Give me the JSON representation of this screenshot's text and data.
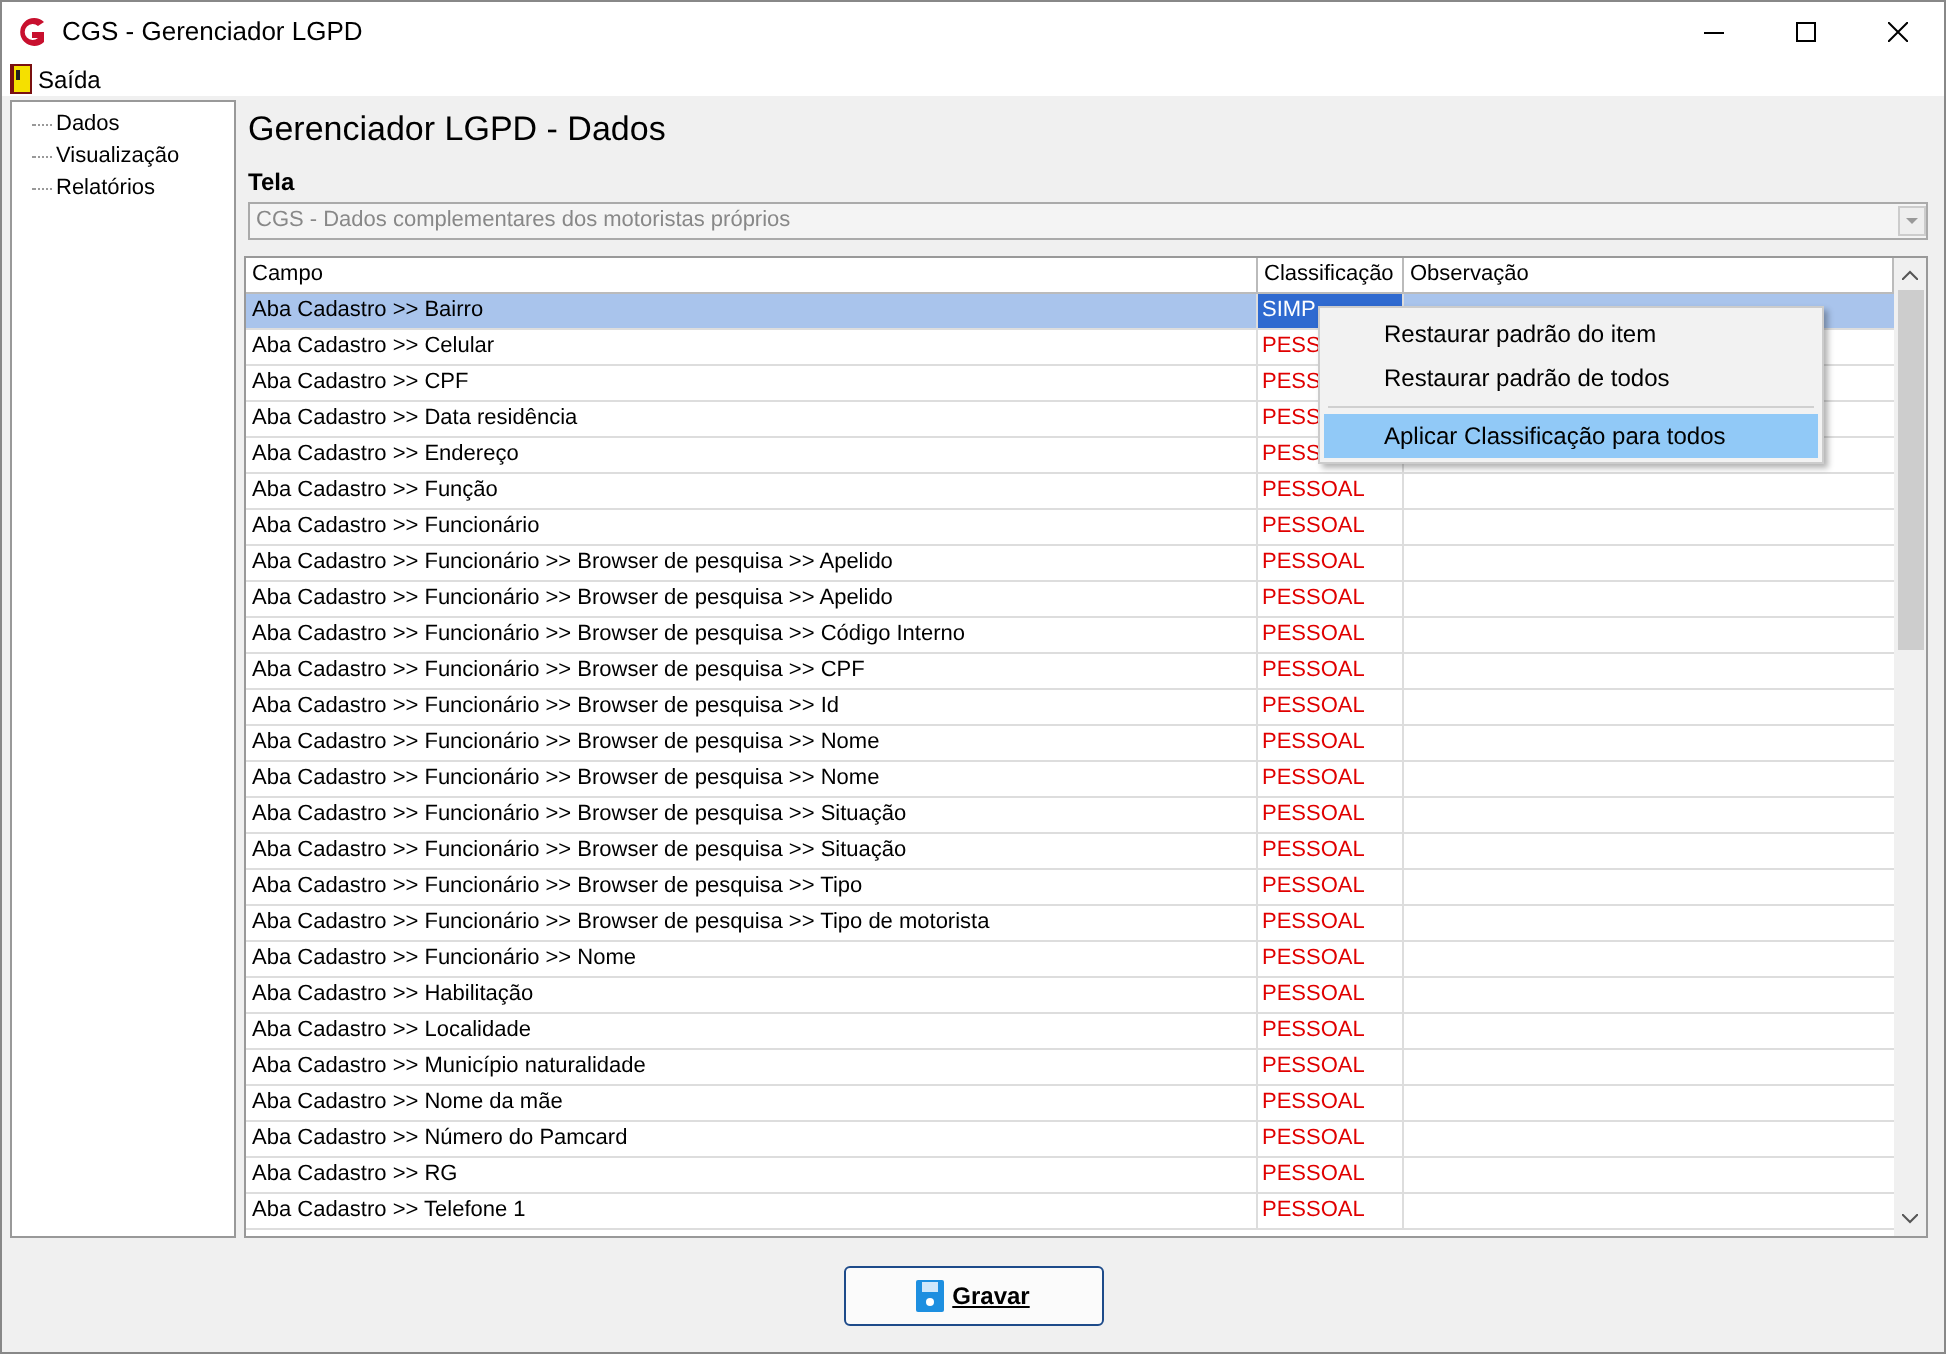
{
  "window": {
    "title": "CGS - Gerenciador LGPD"
  },
  "menu": [
    {
      "label": "Saída"
    }
  ],
  "tree": [
    {
      "label": "Dados"
    },
    {
      "label": "Visualização"
    },
    {
      "label": "Relatórios"
    }
  ],
  "heading": "Gerenciador LGPD - Dados",
  "tela": {
    "label": "Tela",
    "value": "CGS - Dados complementares dos motoristas próprios"
  },
  "table": {
    "columns": [
      "Campo",
      "Classificação",
      "Observação"
    ],
    "rows": [
      {
        "campo": "Aba Cadastro >> Bairro",
        "classificacao": "SIMP",
        "selected": true
      },
      {
        "campo": "Aba Cadastro >> Celular",
        "classificacao": "PESS",
        "selected": false
      },
      {
        "campo": "Aba Cadastro >> CPF",
        "classificacao": "PESS",
        "selected": false
      },
      {
        "campo": "Aba Cadastro >> Data residência",
        "classificacao": "PESS",
        "selected": false
      },
      {
        "campo": "Aba Cadastro >> Endereço",
        "classificacao": "PESS",
        "selected": false
      },
      {
        "campo": "Aba Cadastro >> Função",
        "classificacao": "PESSOAL",
        "selected": false
      },
      {
        "campo": "Aba Cadastro >> Funcionário",
        "classificacao": "PESSOAL",
        "selected": false
      },
      {
        "campo": "Aba Cadastro >> Funcionário >> Browser de pesquisa >> Apelido",
        "classificacao": "PESSOAL",
        "selected": false
      },
      {
        "campo": "Aba Cadastro >> Funcionário >> Browser de pesquisa >> Apelido",
        "classificacao": "PESSOAL",
        "selected": false
      },
      {
        "campo": "Aba Cadastro >> Funcionário >> Browser de pesquisa >> Código Interno",
        "classificacao": "PESSOAL",
        "selected": false
      },
      {
        "campo": "Aba Cadastro >> Funcionário >> Browser de pesquisa >> CPF",
        "classificacao": "PESSOAL",
        "selected": false
      },
      {
        "campo": "Aba Cadastro >> Funcionário >> Browser de pesquisa >> Id",
        "classificacao": "PESSOAL",
        "selected": false
      },
      {
        "campo": "Aba Cadastro >> Funcionário >> Browser de pesquisa >> Nome",
        "classificacao": "PESSOAL",
        "selected": false
      },
      {
        "campo": "Aba Cadastro >> Funcionário >> Browser de pesquisa >> Nome",
        "classificacao": "PESSOAL",
        "selected": false
      },
      {
        "campo": "Aba Cadastro >> Funcionário >> Browser de pesquisa >> Situação",
        "classificacao": "PESSOAL",
        "selected": false
      },
      {
        "campo": "Aba Cadastro >> Funcionário >> Browser de pesquisa >> Situação",
        "classificacao": "PESSOAL",
        "selected": false
      },
      {
        "campo": "Aba Cadastro >> Funcionário >> Browser de pesquisa >> Tipo",
        "classificacao": "PESSOAL",
        "selected": false
      },
      {
        "campo": "Aba Cadastro >> Funcionário >> Browser de pesquisa >> Tipo de motorista",
        "classificacao": "PESSOAL",
        "selected": false
      },
      {
        "campo": "Aba Cadastro >> Funcionário >> Nome",
        "classificacao": "PESSOAL",
        "selected": false
      },
      {
        "campo": "Aba Cadastro >> Habilitação",
        "classificacao": "PESSOAL",
        "selected": false
      },
      {
        "campo": "Aba Cadastro >> Localidade",
        "classificacao": "PESSOAL",
        "selected": false
      },
      {
        "campo": "Aba Cadastro >> Município naturalidade",
        "classificacao": "PESSOAL",
        "selected": false
      },
      {
        "campo": "Aba Cadastro >> Nome da mãe",
        "classificacao": "PESSOAL",
        "selected": false
      },
      {
        "campo": "Aba Cadastro >> Número do Pamcard",
        "classificacao": "PESSOAL",
        "selected": false
      },
      {
        "campo": "Aba Cadastro >> RG",
        "classificacao": "PESSOAL",
        "selected": false
      },
      {
        "campo": "Aba Cadastro >> Telefone 1",
        "classificacao": "PESSOAL",
        "selected": false
      }
    ]
  },
  "context_menu": [
    {
      "label": "Restaurar padrão do item",
      "selected": false
    },
    {
      "label": "Restaurar padrão de todos",
      "selected": false
    },
    {
      "label": "Aplicar Classificação para todos",
      "selected": true
    }
  ],
  "save_button": {
    "label": "Gravar"
  }
}
